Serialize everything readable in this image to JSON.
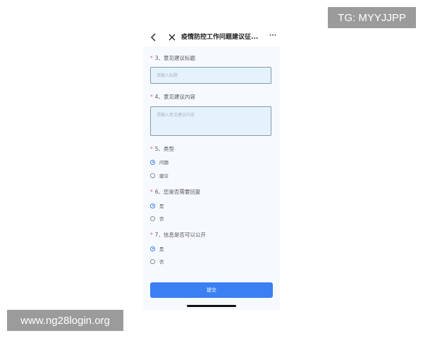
{
  "watermarks": {
    "top_right": "TG: MYYJJPP",
    "bottom_left": "www.ng28login.org"
  },
  "nav": {
    "back_icon": "chevron-left-icon",
    "close_icon": "close-icon",
    "title": "疫情防控工作问题建议征...",
    "more": "···"
  },
  "form": {
    "required_mark": "*",
    "q3": {
      "label": "3、意见建议标题",
      "placeholder": "请输入标题"
    },
    "q4": {
      "label": "4、意见建议内容",
      "placeholder": "请输入意见建议内容"
    },
    "q5": {
      "label": "5、类型",
      "options": [
        {
          "label": "问题",
          "selected": true
        },
        {
          "label": "建议",
          "selected": false
        }
      ]
    },
    "q6": {
      "label": "6、您是否需要回复",
      "options": [
        {
          "label": "是",
          "selected": true
        },
        {
          "label": "否",
          "selected": false
        }
      ]
    },
    "q7": {
      "label": "7、信息是否可以公开",
      "options": [
        {
          "label": "是",
          "selected": true
        },
        {
          "label": "否",
          "selected": false
        }
      ]
    },
    "submit_label": "提交"
  },
  "colors": {
    "accent": "#3a80f2",
    "required": "#e85a6f",
    "input_bg": "#e4f2fb",
    "page_bg": "#f6fafe"
  }
}
